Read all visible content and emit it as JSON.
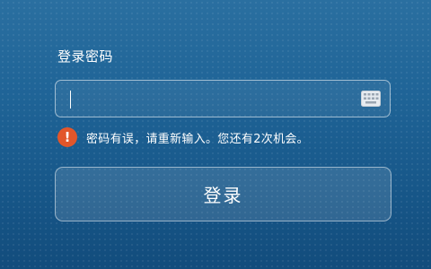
{
  "form": {
    "password_label": "登录密码",
    "password_value": "",
    "keyboard_icon": "keyboard-icon",
    "error_icon_glyph": "!",
    "error_message": "密码有误，请重新输入。您还有2次机会。",
    "login_label": "登录"
  },
  "colors": {
    "background": "#1f6497",
    "error_accent": "#e2562a",
    "text": "#ffffff"
  }
}
